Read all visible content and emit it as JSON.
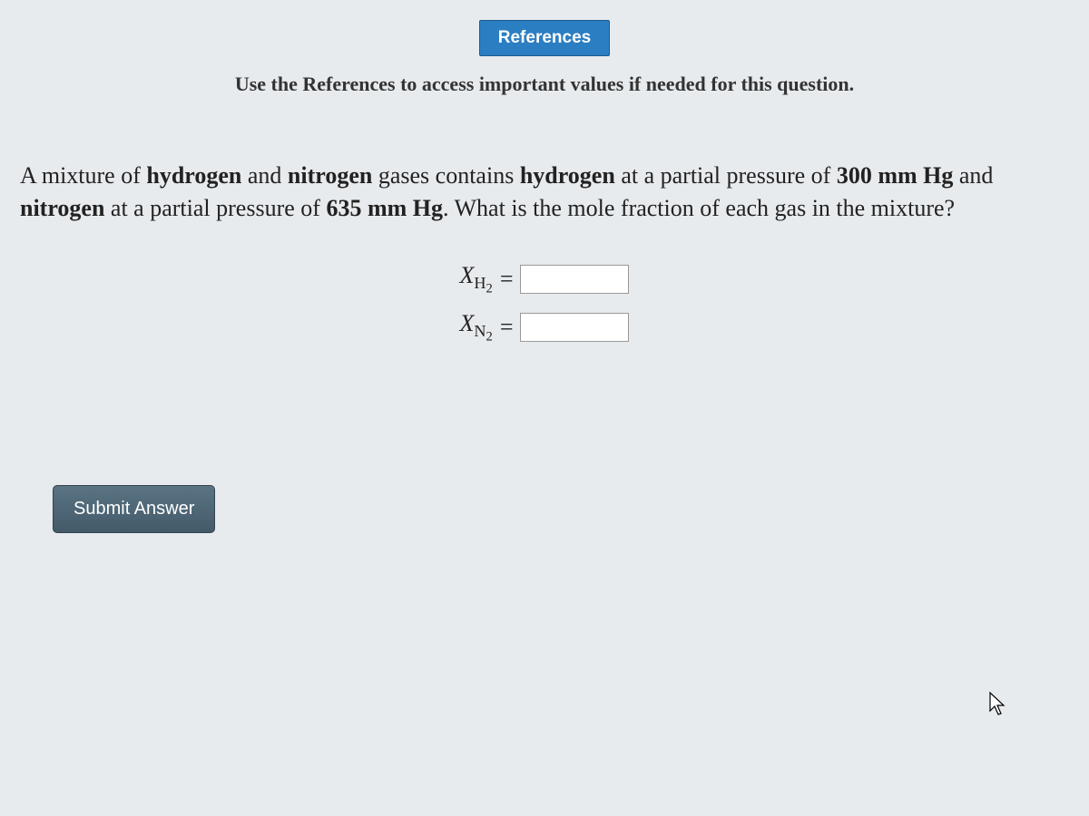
{
  "header": {
    "references_label": "References",
    "instruction": "Use the References to access important values if needed for this question."
  },
  "question": {
    "pre1": "A mixture of ",
    "bold1": "hydrogen",
    "mid1": " and ",
    "bold2": "nitrogen",
    "mid2": " gases contains ",
    "bold3": "hydrogen",
    "mid3": " at a partial pressure of ",
    "bold4": "300 mm Hg",
    "mid4": " and ",
    "bold5": "nitrogen",
    "mid5": " at a partial pressure of ",
    "bold6": "635 mm Hg",
    "end": ". What is the mole fraction of each gas in the mixture?"
  },
  "answers": {
    "row1": {
      "symbol": "X",
      "sub_main": "H",
      "sub_num": "2",
      "equals": "=",
      "value": ""
    },
    "row2": {
      "symbol": "X",
      "sub_main": "N",
      "sub_num": "2",
      "equals": "=",
      "value": ""
    }
  },
  "buttons": {
    "submit": "Submit Answer"
  }
}
